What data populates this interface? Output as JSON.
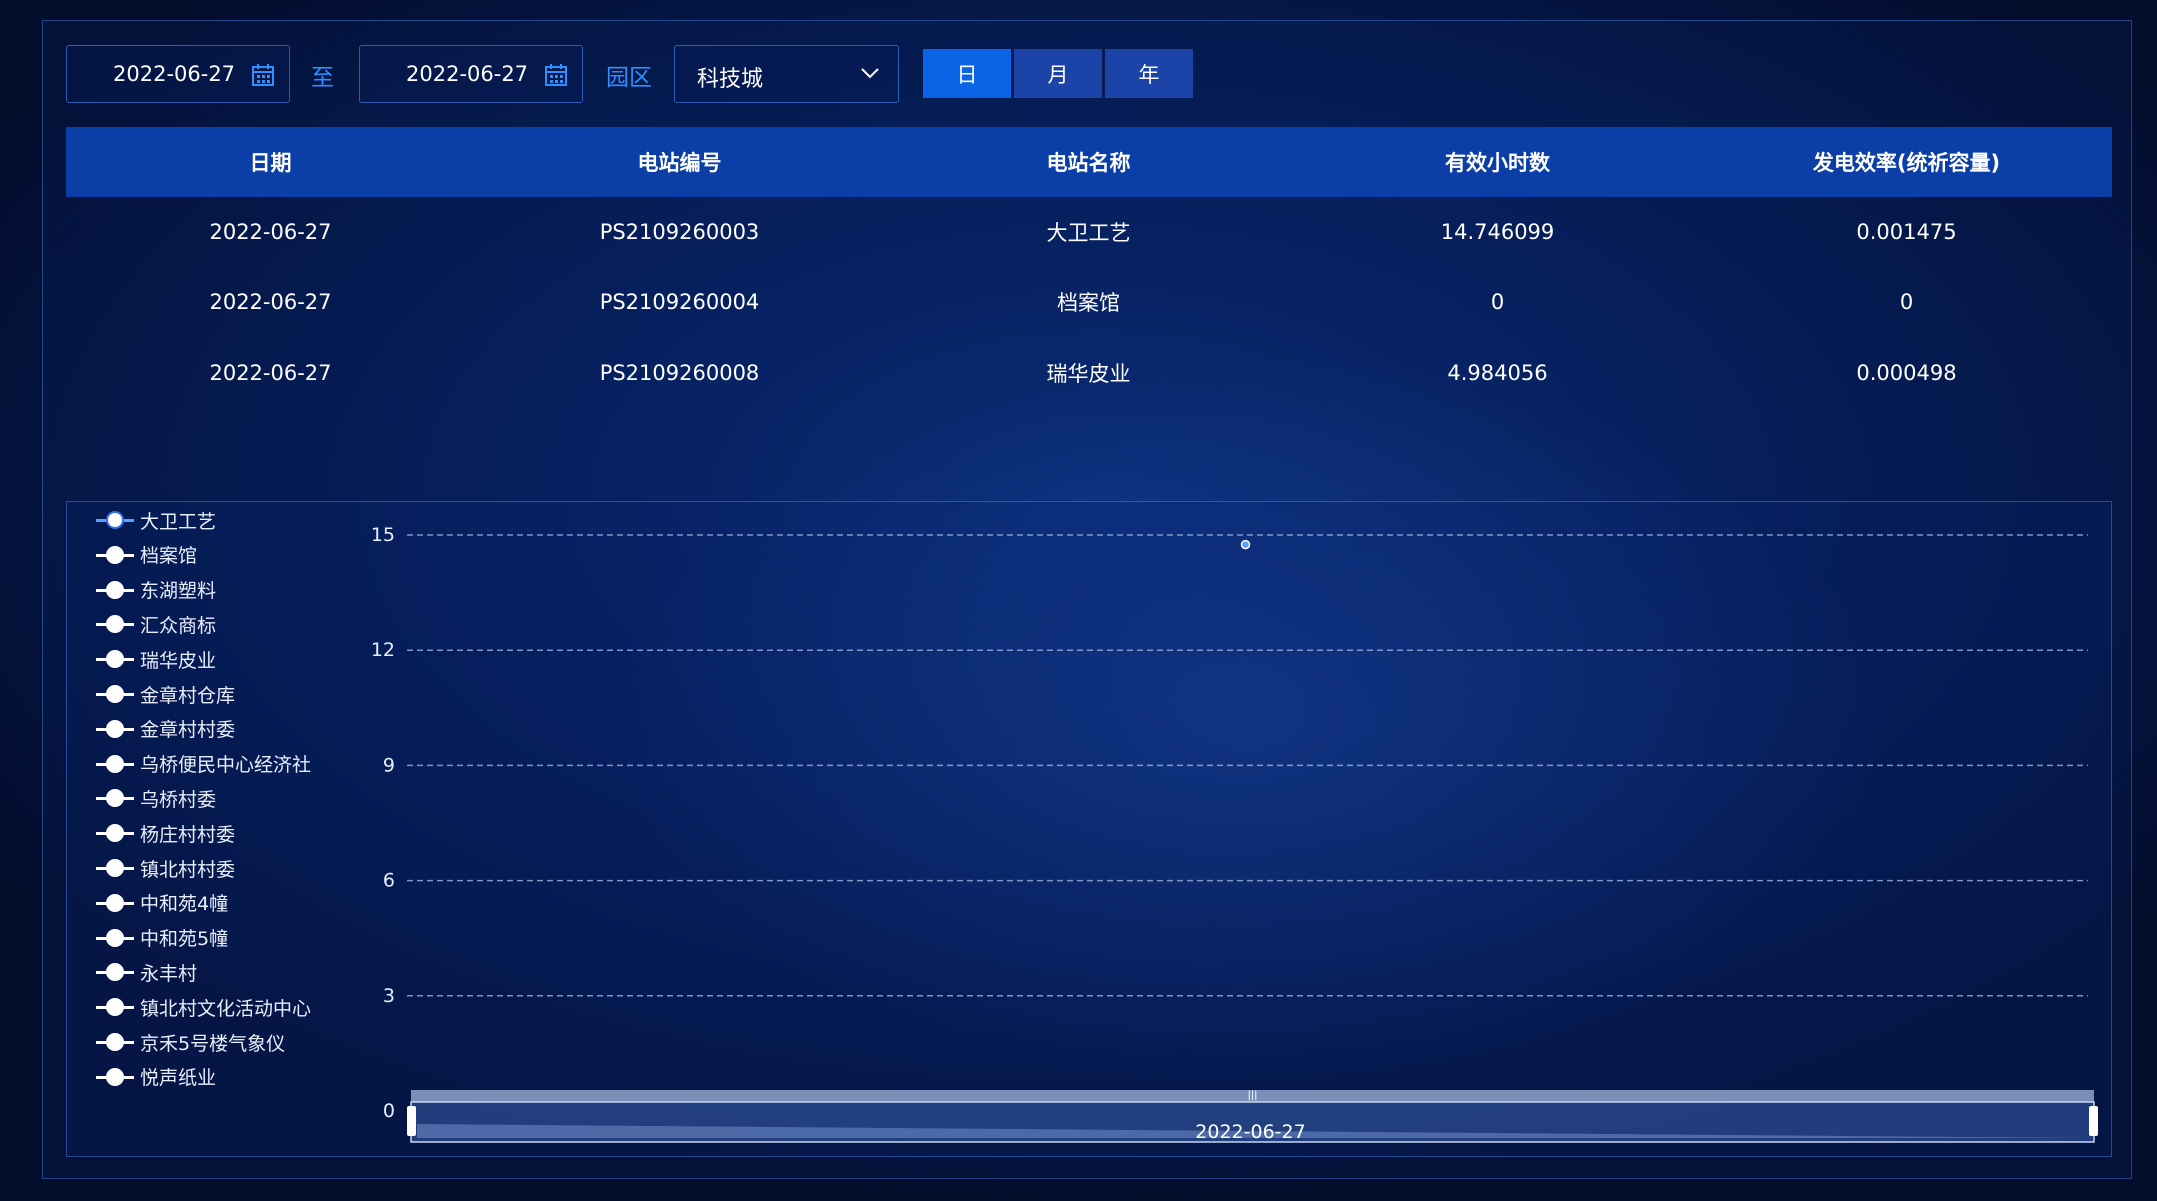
{
  "toolbar": {
    "start_date": "2022-06-27",
    "to_label": "至",
    "end_date": "2022-06-27",
    "park_label": "园区",
    "park_value": "科技城",
    "tabs": [
      {
        "label": "日",
        "active": true
      },
      {
        "label": "月",
        "active": false
      },
      {
        "label": "年",
        "active": false
      }
    ]
  },
  "table": {
    "headers": [
      "日期",
      "电站编号",
      "电站名称",
      "有效小时数",
      "发电效率(统祈容量)"
    ],
    "rows": [
      [
        "2022-06-27",
        "PS2109260003",
        "大卫工艺",
        "14.746099",
        "0.001475"
      ],
      [
        "2022-06-27",
        "PS2109260004",
        "档案馆",
        "0",
        "0"
      ],
      [
        "2022-06-27",
        "PS2109260008",
        "瑞华皮业",
        "4.984056",
        "0.000498"
      ]
    ]
  },
  "legend": [
    "大卫工艺",
    "档案馆",
    "东湖塑料",
    "汇众商标",
    "瑞华皮业",
    "金章村仓库",
    "金章村村委",
    "乌桥便民中心经济社",
    "乌桥村委",
    "杨庄村村委",
    "镇北村村委",
    "中和苑4幢",
    "中和苑5幢",
    "永丰村",
    "镇北村文化活动中心",
    "京禾5号楼气象仪",
    "悦声纸业"
  ],
  "chart_data": {
    "type": "scatter",
    "x": [
      "2022-06-27"
    ],
    "series": [
      {
        "name": "大卫工艺",
        "values": [
          14.75
        ]
      }
    ],
    "y_ticks": [
      0,
      3,
      6,
      9,
      12,
      15
    ],
    "ylim": [
      0,
      15
    ],
    "grid": true,
    "legend_position": "left",
    "slider_label": "2022-06-27",
    "colors": {
      "accent": "#2f8fff",
      "grid": "#9fb4e0",
      "point": "#5aa0ff"
    }
  },
  "colors": {
    "header_bg": "#0b3ea6",
    "tab_active": "#0b63e6",
    "tab_inactive": "#1b43a8",
    "label_blue": "#2f8fff"
  }
}
